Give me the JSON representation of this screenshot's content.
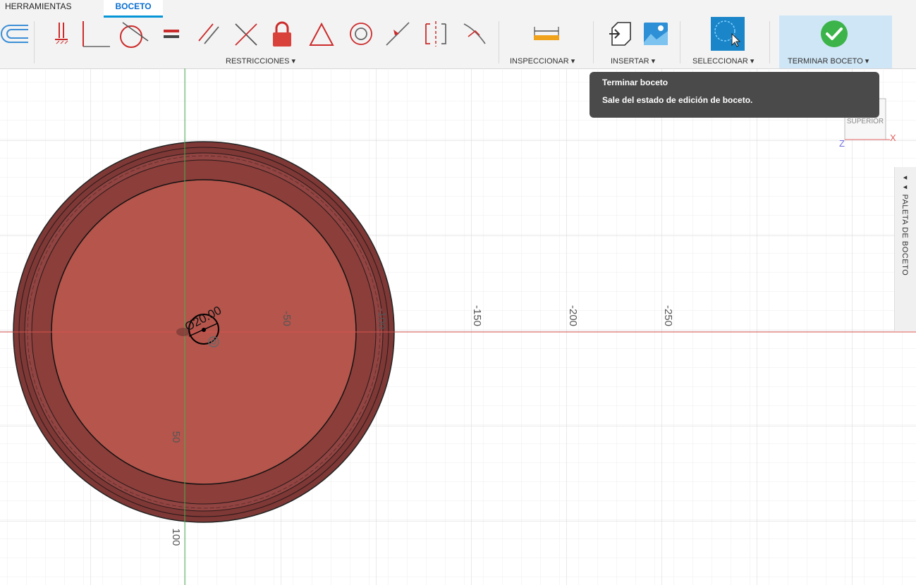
{
  "tabs": {
    "herramientas": "HERRAMIENTAS",
    "boceto": "BOCETO"
  },
  "groups": {
    "restricciones": "RESTRICCIONES ▾",
    "inspeccionar": "INSPECCIONAR ▾",
    "insertar": "INSERTAR ▾",
    "seleccionar": "SELECCIONAR ▾",
    "terminar": "TERMINAR BOCETO ▾"
  },
  "tooltip": {
    "title": "Terminar boceto",
    "body": "Sale del estado de edición de boceto."
  },
  "viewcube": {
    "face": "SUPERIOR",
    "axis_x": "X",
    "axis_z": "Z"
  },
  "palette": {
    "label": "PALETA DE BOCETO"
  },
  "dimension": {
    "label": "Ø20.00"
  },
  "rulers": {
    "horizontal": [
      "-50",
      "-100",
      "-150",
      "-200",
      "-250"
    ],
    "vertical": [
      "50",
      "100"
    ]
  },
  "colors": {
    "sketch_fill": "#b5554c",
    "ring_fill": "#8c3e3a",
    "select_blue": "#1a85c8",
    "finish_green": "#3cb44a"
  }
}
